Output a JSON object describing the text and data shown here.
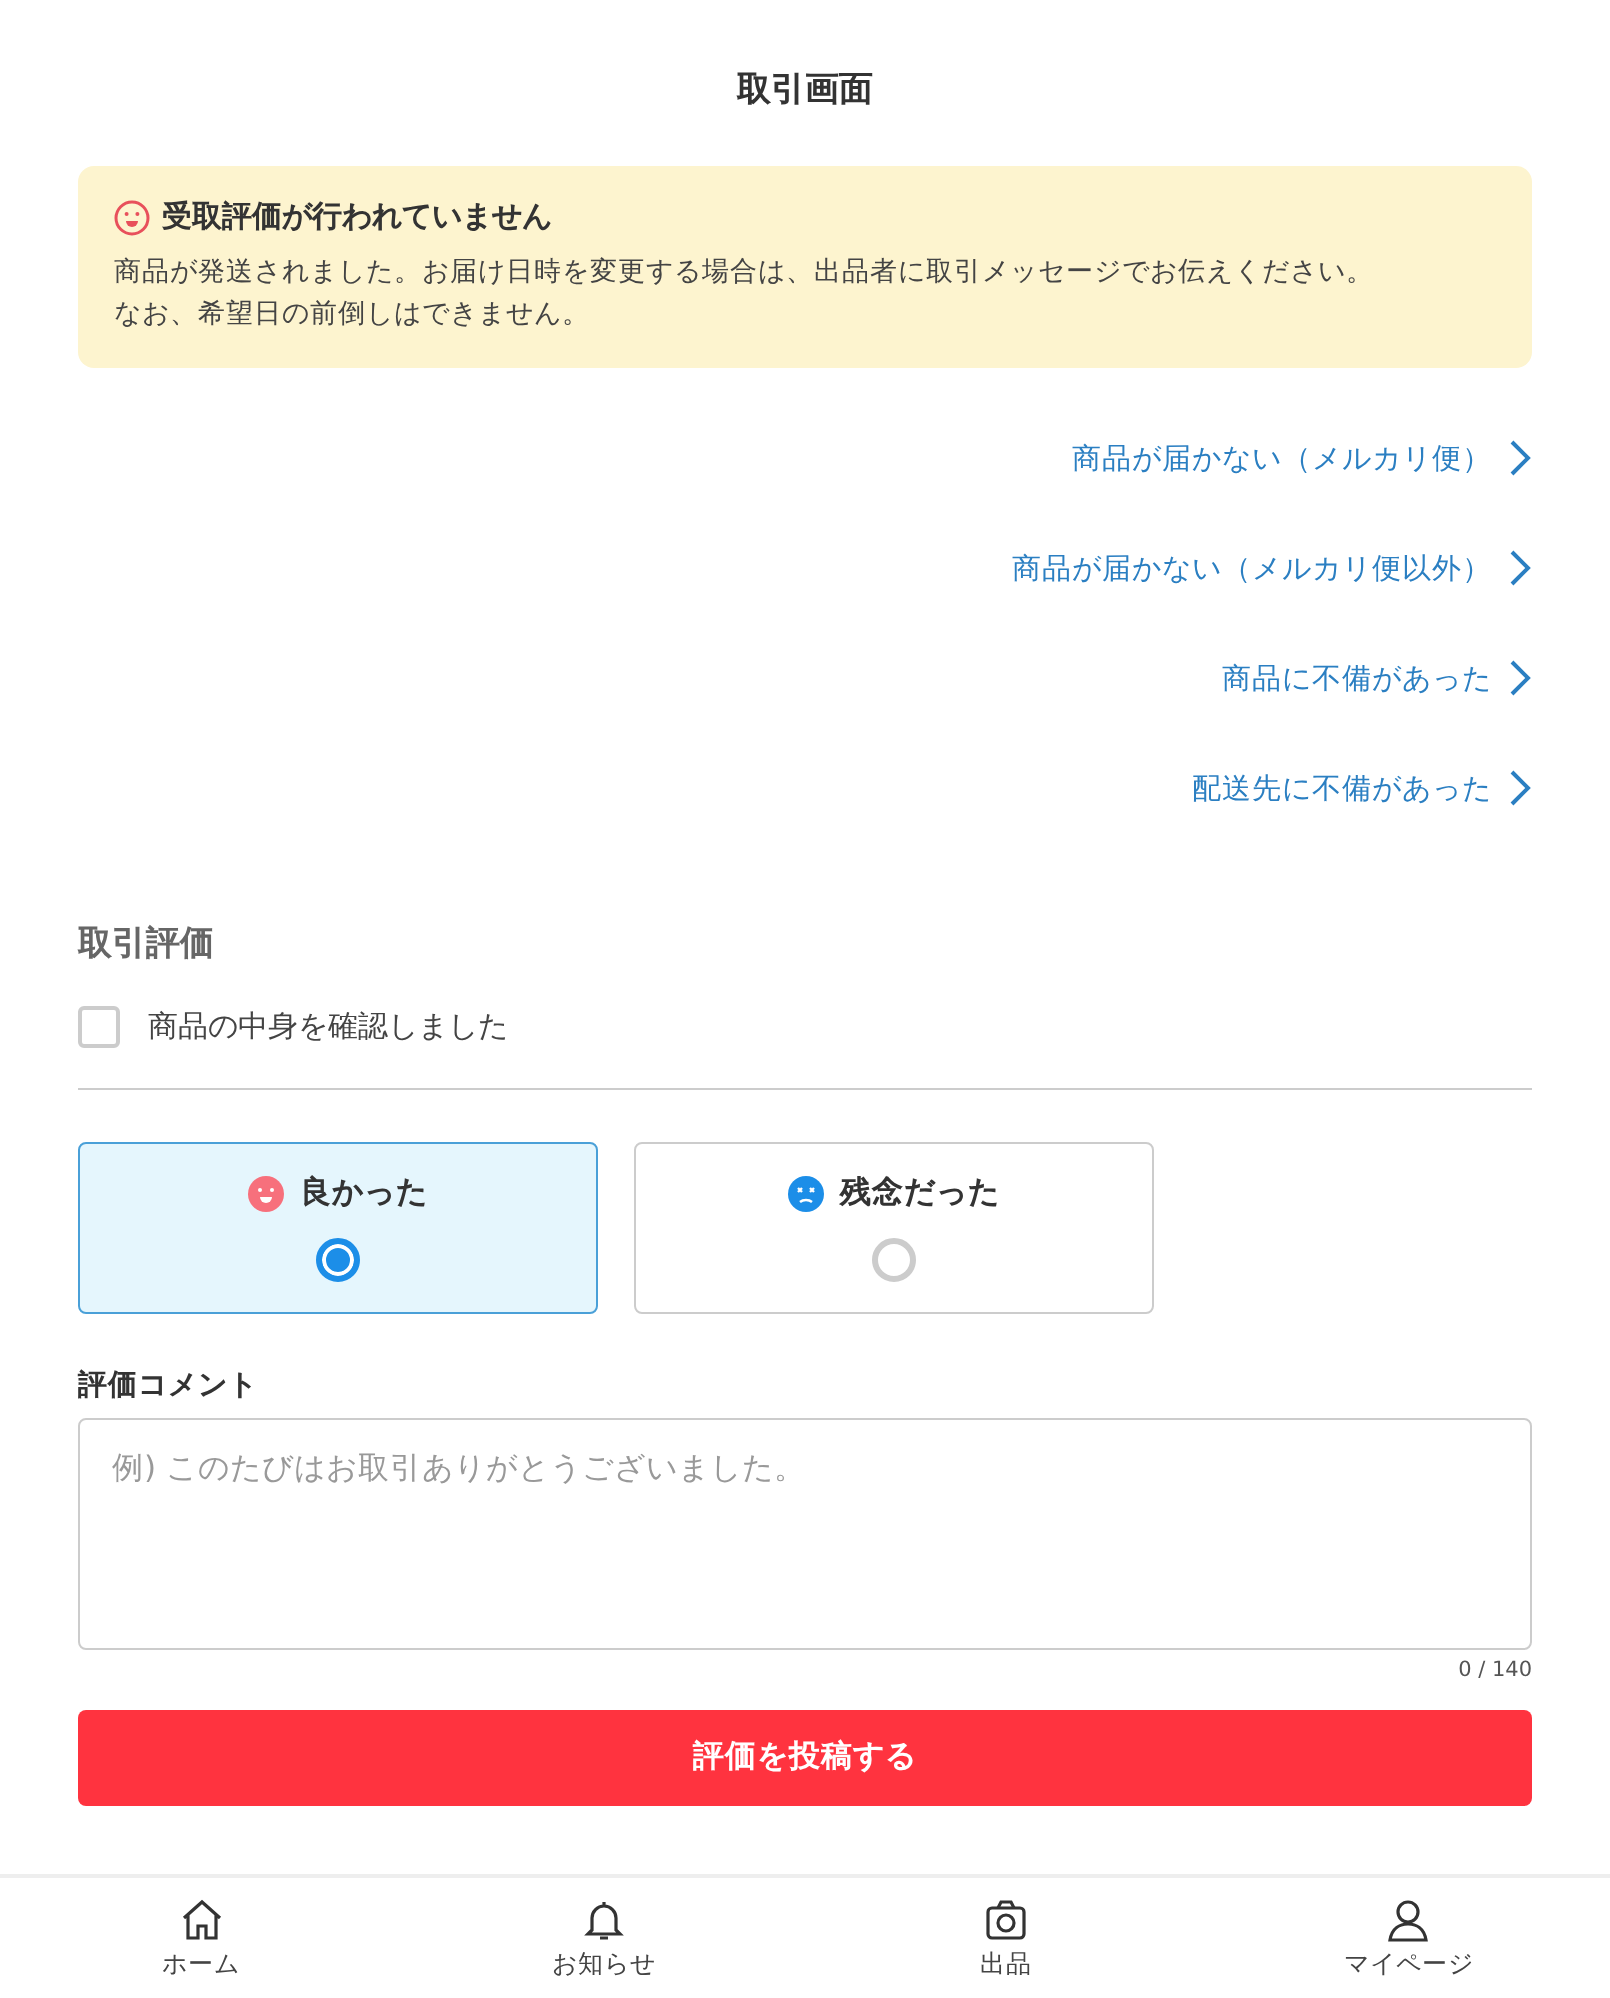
{
  "header": {
    "title": "取引画面"
  },
  "notice": {
    "title": "受取評価が行われていません",
    "body_lines": [
      "商品が発送されました。お届け日時を変更する場合は、出品者に取引メッセージでお伝えください。",
      "なお、希望日の前倒しはできません。"
    ]
  },
  "help_links": [
    "商品が届かない（メルカリ便）",
    "商品が届かない（メルカリ便以外）",
    "商品に不備があった",
    "配送先に不備があった"
  ],
  "rating": {
    "heading": "取引評価",
    "confirm": {
      "label": "商品の中身を確認しました",
      "checked": false
    },
    "options": [
      {
        "kind": "good",
        "label": "良かった",
        "selected": true
      },
      {
        "kind": "bad",
        "label": "残念だった",
        "selected": false
      }
    ],
    "comment_label": "評価コメント",
    "comment_placeholder": "例) このたびはお取引ありがとうございました。",
    "counter": "0 / 140",
    "submit": "評価を投稿する"
  },
  "tab_bar": [
    {
      "kind": "home",
      "label": "ホーム"
    },
    {
      "kind": "bell",
      "label": "お知らせ"
    },
    {
      "kind": "camera",
      "label": "出品"
    },
    {
      "kind": "person",
      "label": "マイページ"
    }
  ]
}
